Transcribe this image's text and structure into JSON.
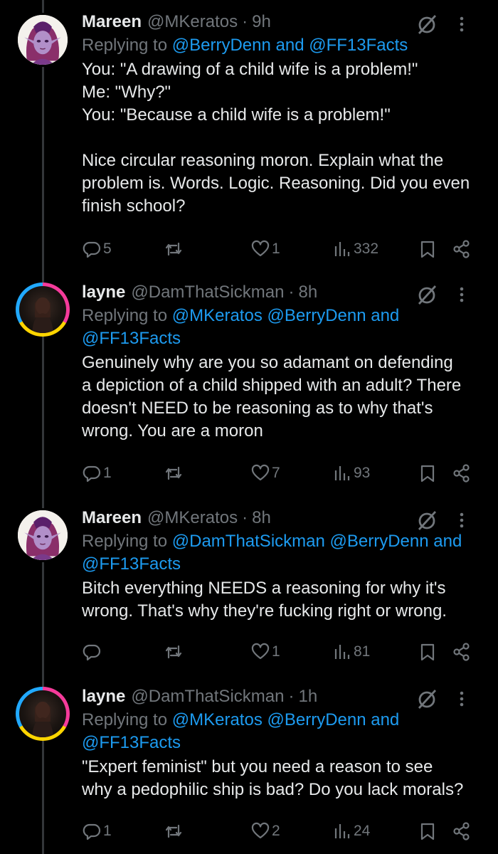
{
  "tweets": [
    {
      "name": "Mareen",
      "handle": "@MKeratos",
      "time": "9h",
      "replying_prefix": "Replying to ",
      "mentions": "@BerryDenn and @FF13Facts",
      "text": "You: \"A drawing of a child wife is a problem!\"\nMe: \"Why?\"\nYou: \"Because a child wife is a problem!\"\n\nNice circular reasoning moron. Explain what the\nproblem is. Words. Logic. Reasoning. Did you even\nfinish school?",
      "replies": "5",
      "retweets": "",
      "likes": "1",
      "views": "332"
    },
    {
      "name": "layne",
      "handle": "@DamThatSickman",
      "time": "8h",
      "replying_prefix": "Replying to ",
      "mentions": "@MKeratos @BerryDenn and\n@FF13Facts",
      "text": "Genuinely why are you so adamant on defending\na depiction of a child shipped with an adult? There\ndoesn't NEED to be reasoning as to why that's\nwrong. You are a moron",
      "replies": "1",
      "retweets": "",
      "likes": "7",
      "views": "93"
    },
    {
      "name": "Mareen",
      "handle": "@MKeratos",
      "time": "8h",
      "replying_prefix": "Replying to ",
      "mentions": "@DamThatSickman @BerryDenn and\n@FF13Facts",
      "text": "Bitch everything NEEDS a reasoning for why it's\nwrong. That's why they're fucking right or wrong.",
      "replies": "",
      "retweets": "",
      "likes": "1",
      "views": "81"
    },
    {
      "name": "layne",
      "handle": "@DamThatSickman",
      "time": "1h",
      "replying_prefix": "Replying to ",
      "mentions": "@MKeratos @BerryDenn and\n@FF13Facts",
      "text": "\"Expert feminist\" but you need a reason to see\nwhy a pedophilic ship is bad? Do you lack morals?",
      "replies": "1",
      "retweets": "",
      "likes": "2",
      "views": "24"
    }
  ],
  "separator": "·",
  "icons": {
    "reply": "reply-icon",
    "retweet": "retweet-icon",
    "like": "heart-icon",
    "views": "views-icon",
    "bookmark": "bookmark-icon",
    "share": "share-icon",
    "grok": "grok-icon",
    "more": "more-icon"
  },
  "colors": {
    "background": "#000000",
    "text": "#e7e9ea",
    "muted": "#71767b",
    "link": "#1d9bf0"
  }
}
